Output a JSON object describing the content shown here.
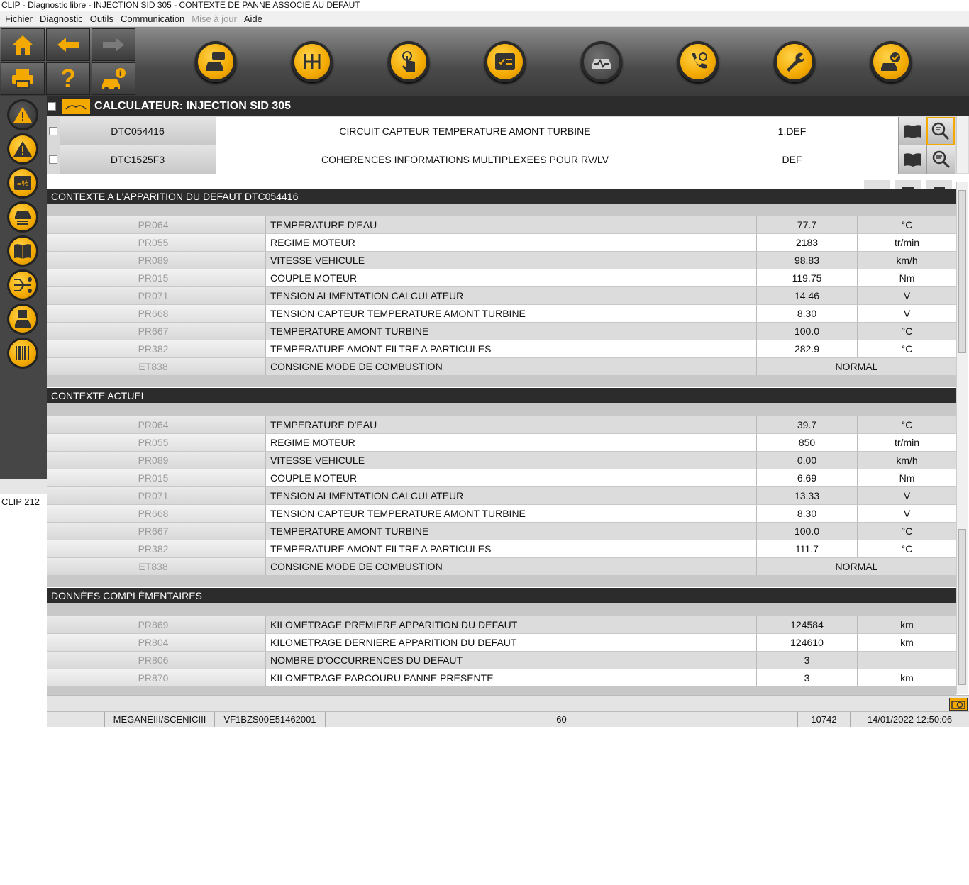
{
  "window_title": "CLIP - Diagnostic libre - INJECTION SID 305 - CONTEXTE DE PANNE ASSOCIE AU DEFAUT",
  "menu": [
    {
      "label": "Fichier",
      "disabled": false
    },
    {
      "label": "Diagnostic",
      "disabled": false
    },
    {
      "label": "Outils",
      "disabled": false
    },
    {
      "label": "Communication",
      "disabled": false
    },
    {
      "label": "Mise à jour",
      "disabled": true
    },
    {
      "label": "Aide",
      "disabled": false
    }
  ],
  "toolbar": {
    "small_buttons": [
      "home-icon",
      "back-arrow-icon",
      "forward-arrow-icon",
      "printer-icon",
      "help-icon",
      "vehicle-info-icon"
    ],
    "big_buttons": [
      "vehicle-message-icon",
      "gearbox-icon",
      "touch-icon",
      "checklist-icon",
      "vehicle-diagnostic-icon",
      "phone-support-icon",
      "wrench-icon",
      "vehicle-check-icon"
    ],
    "active_big_button": "vehicle-diagnostic-icon"
  },
  "sidebar": {
    "buttons": [
      "warning-icon",
      "warning-icon",
      "percentage-icon",
      "vehicle-list-icon",
      "book-icon",
      "wiring-icon",
      "vehicle-save-icon",
      "barcode-icon"
    ],
    "active_index": 0,
    "clip_label": "CLIP 212"
  },
  "calculator": {
    "title": "CALCULATEUR: INJECTION SID 305"
  },
  "dtc_list": [
    {
      "code": "DTC054416",
      "description": "CIRCUIT CAPTEUR TEMPERATURE AMONT TURBINE",
      "status": "1.DEF"
    },
    {
      "code": "DTC1525F3",
      "description": "COHERENCES INFORMATIONS MULTIPLEXEES POUR RV/LV",
      "status": "DEF"
    }
  ],
  "sections": [
    {
      "title": "CONTEXTE A L'APPARITION DU DEFAUT DTC054416",
      "rows": [
        {
          "id": "PR064",
          "label": "TEMPERATURE D'EAU",
          "value": "77.7",
          "unit": "°C"
        },
        {
          "id": "PR055",
          "label": "REGIME MOTEUR",
          "value": "2183",
          "unit": "tr/min"
        },
        {
          "id": "PR089",
          "label": "VITESSE VEHICULE",
          "value": "98.83",
          "unit": "km/h"
        },
        {
          "id": "PR015",
          "label": "COUPLE MOTEUR",
          "value": "119.75",
          "unit": "Nm"
        },
        {
          "id": "PR071",
          "label": "TENSION ALIMENTATION CALCULATEUR",
          "value": "14.46",
          "unit": "V"
        },
        {
          "id": "PR668",
          "label": "TENSION CAPTEUR TEMPERATURE AMONT TURBINE",
          "value": "8.30",
          "unit": "V"
        },
        {
          "id": "PR667",
          "label": "TEMPERATURE AMONT TURBINE",
          "value": "100.0",
          "unit": "°C"
        },
        {
          "id": "PR382",
          "label": "TEMPERATURE AMONT FILTRE A PARTICULES",
          "value": "282.9",
          "unit": "°C"
        },
        {
          "id": "ET838",
          "label": "CONSIGNE MODE DE COMBUSTION",
          "value": "NORMAL",
          "unit": null
        }
      ]
    },
    {
      "title": "CONTEXTE ACTUEL",
      "rows": [
        {
          "id": "PR064",
          "label": "TEMPERATURE D'EAU",
          "value": "39.7",
          "unit": "°C"
        },
        {
          "id": "PR055",
          "label": "REGIME MOTEUR",
          "value": "850",
          "unit": "tr/min"
        },
        {
          "id": "PR089",
          "label": "VITESSE VEHICULE",
          "value": "0.00",
          "unit": "km/h"
        },
        {
          "id": "PR015",
          "label": "COUPLE MOTEUR",
          "value": "6.69",
          "unit": "Nm"
        },
        {
          "id": "PR071",
          "label": "TENSION ALIMENTATION CALCULATEUR",
          "value": "13.33",
          "unit": "V"
        },
        {
          "id": "PR668",
          "label": "TENSION CAPTEUR TEMPERATURE AMONT TURBINE",
          "value": "8.30",
          "unit": "V"
        },
        {
          "id": "PR667",
          "label": "TEMPERATURE AMONT TURBINE",
          "value": "100.0",
          "unit": "°C"
        },
        {
          "id": "PR382",
          "label": "TEMPERATURE AMONT FILTRE A PARTICULES",
          "value": "111.7",
          "unit": "°C"
        },
        {
          "id": "ET838",
          "label": "CONSIGNE MODE DE COMBUSTION",
          "value": "NORMAL",
          "unit": null
        }
      ]
    },
    {
      "title": "DONNÉES COMPLÉMENTAIRES",
      "rows": [
        {
          "id": "PR869",
          "label": "KILOMETRAGE PREMIERE APPARITION DU DEFAUT",
          "value": "124584",
          "unit": "km"
        },
        {
          "id": "PR804",
          "label": "KILOMETRAGE DERNIERE APPARITION DU DEFAUT",
          "value": "124610",
          "unit": "km"
        },
        {
          "id": "PR806",
          "label": "NOMBRE D'OCCURRENCES DU DEFAUT",
          "value": "3",
          "unit": ""
        },
        {
          "id": "PR870",
          "label": "KILOMETRAGE PARCOURU PANNE PRESENTE",
          "value": "3",
          "unit": "km"
        }
      ]
    }
  ],
  "statusbar": {
    "vehicle": "MEGANEIII/SCENICIII",
    "vin": "VF1BZS00E51462001",
    "field3": "60",
    "field4": "10742",
    "datetime": "14/01/2022 12:50:06"
  },
  "colors": {
    "accent": "#f3a900",
    "header_bg": "#2c2c2c",
    "toolbar_bg": "#4a4a4a"
  }
}
